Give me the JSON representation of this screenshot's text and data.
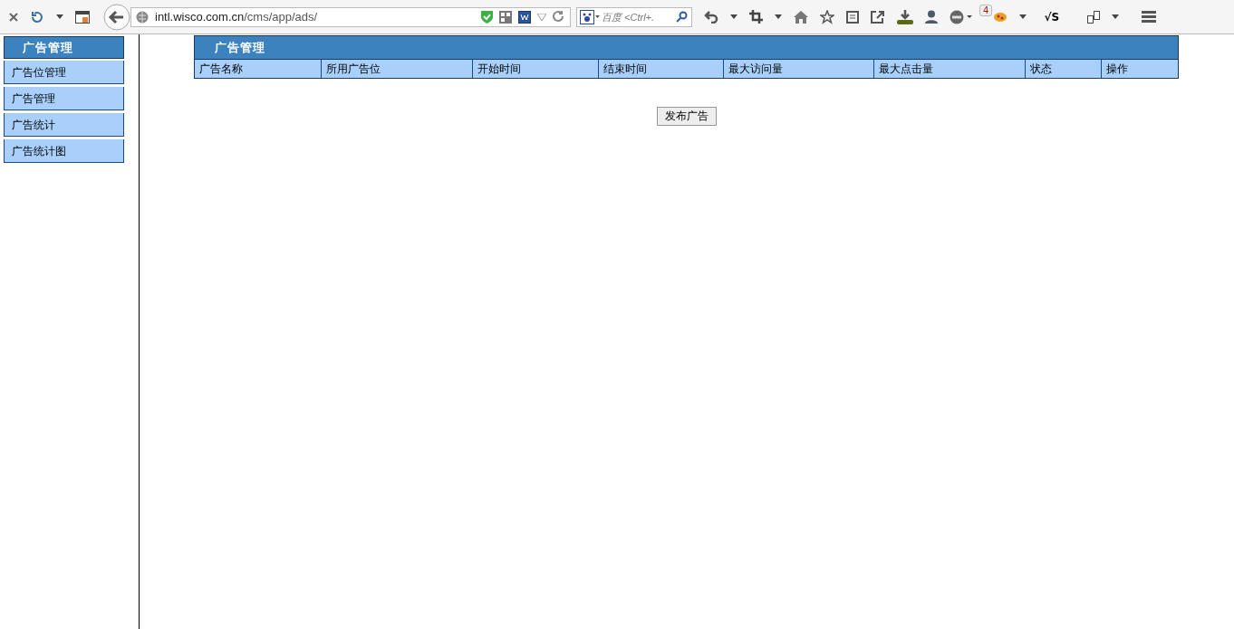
{
  "browser": {
    "url_host": "intl.wisco.com.cn",
    "url_path": "/cms/app/ads/",
    "search_placeholder": "百度 <Ctrl+.",
    "badge": "4",
    "addon_label": "√S"
  },
  "sidebar": {
    "title": "广告管理",
    "items": [
      {
        "label": "广告位管理"
      },
      {
        "label": "广告管理"
      },
      {
        "label": "广告统计"
      },
      {
        "label": "广告统计图"
      }
    ]
  },
  "panel": {
    "title": "广告管理",
    "columns": [
      "广告名称",
      "所用广告位",
      "开始时间",
      "结束时间",
      "最大访问量",
      "最大点击量",
      "状态",
      "操作"
    ]
  },
  "publish_button": "发布广告"
}
